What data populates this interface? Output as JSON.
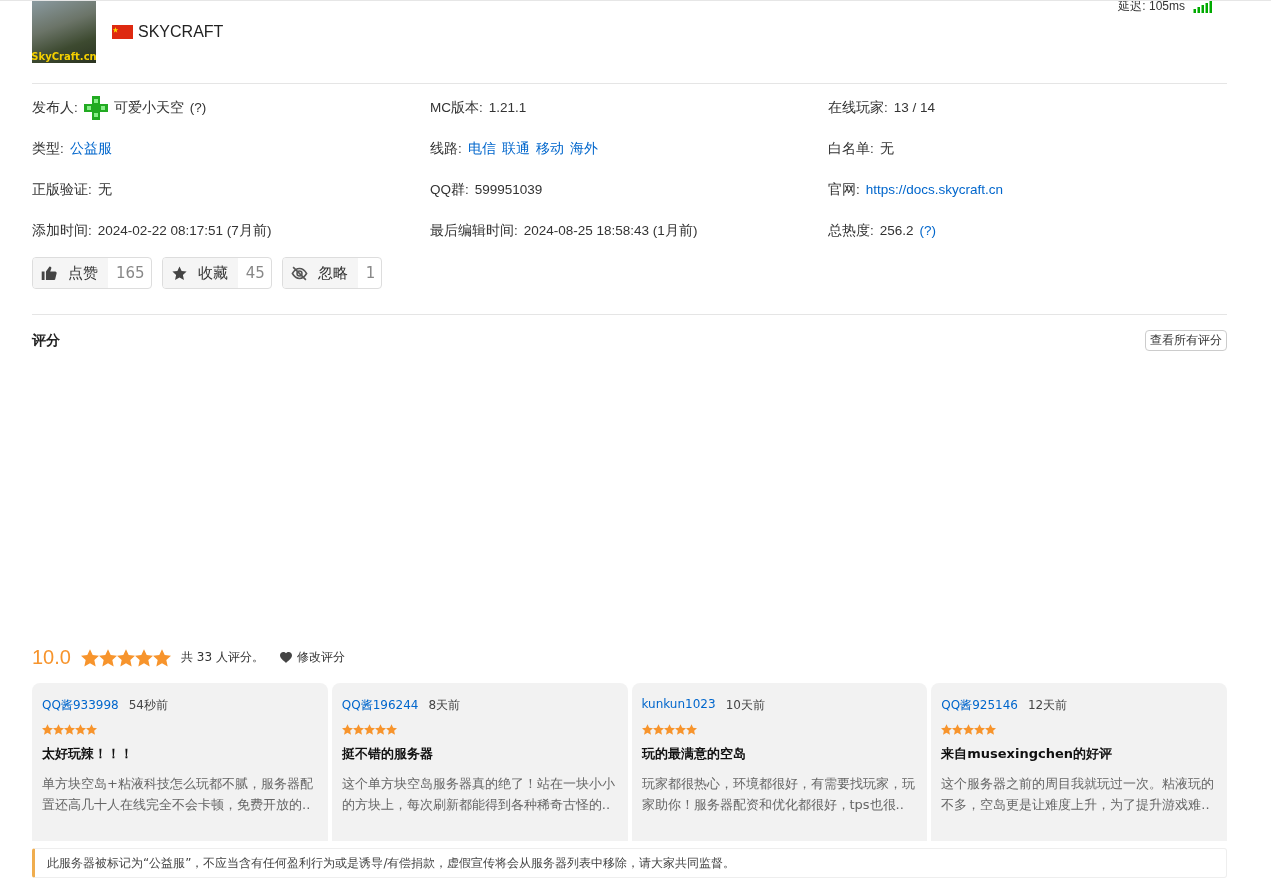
{
  "header": {
    "logo_caption": "SkyCraft.cn",
    "server_name": "SKYCRAFT",
    "latency": "延迟: 105ms"
  },
  "info": [
    {
      "label": "发布人:",
      "parts": [
        {
          "kind": "user",
          "text": "可爱小天空"
        },
        {
          "kind": "text",
          "text": "(?)"
        }
      ]
    },
    {
      "label": "MC版本:",
      "parts": [
        {
          "kind": "text",
          "text": "1.21.1"
        }
      ]
    },
    {
      "label": "在线玩家:",
      "parts": [
        {
          "kind": "text",
          "text": "13 / 14"
        }
      ]
    },
    {
      "label": "类型:",
      "parts": [
        {
          "kind": "link",
          "text": "公益服"
        }
      ]
    },
    {
      "label": "线路:",
      "parts": [
        {
          "kind": "link",
          "text": "电信"
        },
        {
          "kind": "link",
          "text": "联通"
        },
        {
          "kind": "link",
          "text": "移动"
        },
        {
          "kind": "link",
          "text": "海外"
        }
      ]
    },
    {
      "label": "白名单:",
      "parts": [
        {
          "kind": "text",
          "text": "无"
        }
      ]
    },
    {
      "label": "正版验证:",
      "parts": [
        {
          "kind": "text",
          "text": "无"
        }
      ]
    },
    {
      "label": "QQ群:",
      "parts": [
        {
          "kind": "text",
          "text": "599951039"
        }
      ]
    },
    {
      "label": "官网:",
      "parts": [
        {
          "kind": "link",
          "text": "https://docs.skycraft.cn"
        }
      ]
    },
    {
      "label": "添加时间:",
      "parts": [
        {
          "kind": "text",
          "text": "2024-02-22 08:17:51 (7月前)"
        }
      ]
    },
    {
      "label": "最后编辑时间:",
      "parts": [
        {
          "kind": "text",
          "text": "2024-08-25 18:58:43 (1月前)"
        }
      ]
    },
    {
      "label": "总热度:",
      "parts": [
        {
          "kind": "text",
          "text": "256.2"
        },
        {
          "kind": "link",
          "text": "(?)"
        }
      ]
    }
  ],
  "actions": [
    {
      "kind": "like",
      "label": "点赞",
      "count": "165"
    },
    {
      "kind": "favorite",
      "label": "收藏",
      "count": "45"
    },
    {
      "kind": "ignore",
      "label": "忽略",
      "count": "1"
    }
  ],
  "ratings": {
    "title": "评分",
    "view_all": "查看所有评分",
    "score": "10.0",
    "stars": 5,
    "summary": "共 33 人评分。",
    "edit": "修改评分",
    "reviews": [
      {
        "user": "QQ酱933998",
        "time": "54秒前",
        "stars": 5,
        "title": "太好玩辣！！！",
        "text": "单方块空岛+粘液科技怎么玩都不腻，服务器配置还高几十人在线完全不会卡顿，免费开放的.."
      },
      {
        "user": "QQ酱196244",
        "time": "8天前",
        "stars": 5,
        "title": "挺不错的服务器",
        "text": "这个单方块空岛服务器真的绝了！站在一块小小的方块上，每次刷新都能得到各种稀奇古怪的.."
      },
      {
        "user": "kunkun1023",
        "time": "10天前",
        "stars": 5,
        "title": "玩的最满意的空岛",
        "text": "玩家都很热心，环境都很好，有需要找玩家，玩家助你！服务器配资和优化都很好，tps也很.."
      },
      {
        "user": "QQ酱925146",
        "time": "12天前",
        "stars": 5,
        "title": "来自musexingchen的好评",
        "text": "这个服务器之前的周目我就玩过一次。粘液玩的不多，空岛更是让难度上升，为了提升游戏难.."
      }
    ]
  },
  "notice": "此服务器被标记为“公益服”，不应当含有任何盈利行为或是诱导/有偿捐款，虚假宣传将会从服务器列表中移除，请大家共同监督。"
}
